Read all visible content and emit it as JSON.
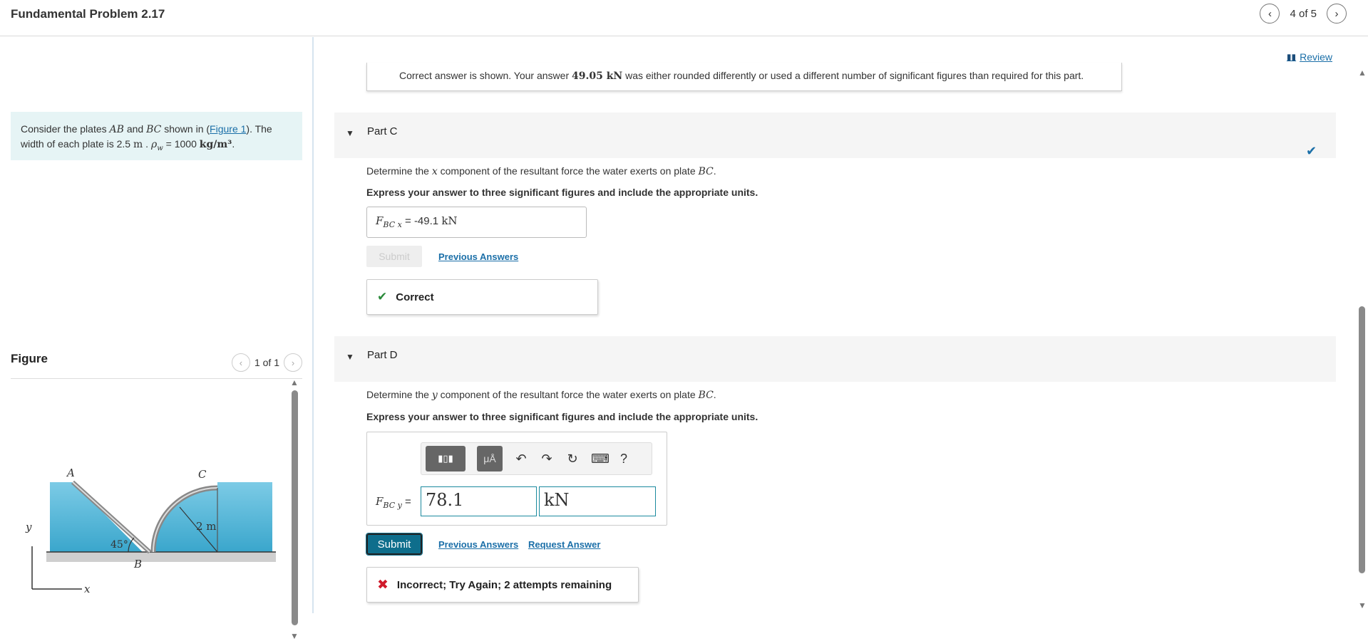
{
  "header": {
    "title": "Fundamental Problem 2.17",
    "page_count": "4 of 5"
  },
  "problem": {
    "text_1": "Consider the plates ",
    "ab": "AB",
    "text_and": " and ",
    "bc": "BC",
    "text_shown": " shown in (",
    "figure_link": "Figure 1",
    "text_after": "). The width of each plate is 2.5 ",
    "unit_m": "m",
    "text_rho": " . ",
    "rho": "ρ",
    "rho_sub": "w",
    "eq": " = 1000 ",
    "density_unit": "kg/m³",
    "period": "."
  },
  "figure_panel": {
    "label": "Figure",
    "page": "1 of 1",
    "labels": {
      "a": "A",
      "b": "B",
      "c": "C",
      "two_m": "2 m",
      "angle": "45°",
      "x": "x",
      "y": "y"
    }
  },
  "review": {
    "label": "Review"
  },
  "note": {
    "text_before": "Correct answer is shown. Your answer ",
    "answer": "49.05 kN",
    "text_after": " was either rounded differently or used a different number of significant figures than required for this part."
  },
  "part_c": {
    "name": "Part C",
    "prompt_before": "Determine the ",
    "prompt_var": "x",
    "prompt_after": " component of the resultant force the water exerts on plate ",
    "plate": "BC",
    "express": "Express your answer to three significant figures and include the appropriate units.",
    "var_main": "F",
    "var_sub": "BC x",
    "eq": " = ",
    "answer_value": "-49.1",
    "answer_unit": "kN",
    "submit": "Submit",
    "previous_answers": "Previous Answers",
    "feedback": "Correct"
  },
  "part_d": {
    "name": "Part D",
    "prompt_before": "Determine the ",
    "prompt_var": "y",
    "prompt_after": " component of the resultant force the water exerts on plate ",
    "plate": "BC",
    "express": "Express your answer to three significant figures and include the appropriate units.",
    "var_main": "F",
    "var_sub": "BC y",
    "eq": " = ",
    "value_input": "78.1",
    "unit_input": "kN",
    "toolbar": {
      "mu": "μÅ",
      "help": "?"
    },
    "submit": "Submit",
    "previous_answers": "Previous Answers",
    "request_answer": "Request Answer",
    "feedback": "Incorrect; Try Again; 2 attempts remaining"
  },
  "colors": {
    "accent": "#0e6e8c",
    "link": "#1b6fa8",
    "correct": "#2a8a3a",
    "incorrect": "#d01a2b",
    "problem_bg": "#e6f4f5",
    "water": "#55b9d9"
  }
}
